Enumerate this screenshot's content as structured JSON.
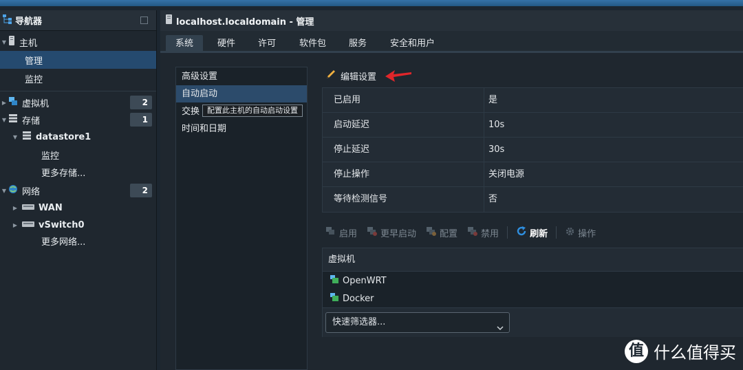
{
  "navigator": {
    "title": "导航器",
    "host": "主机",
    "host_manage": "管理",
    "host_monitor": "监控",
    "vms": "虚拟机",
    "vms_count": "2",
    "storage": "存储",
    "storage_count": "1",
    "datastore": "datastore1",
    "datastore_monitor": "监控",
    "more_storage": "更多存储...",
    "network": "网络",
    "network_count": "2",
    "wan": "WAN",
    "vswitch": "vSwitch0",
    "more_network": "更多网络..."
  },
  "window": {
    "title": "localhost.localdomain - 管理"
  },
  "tabs": [
    "系统",
    "硬件",
    "许可",
    "软件包",
    "服务",
    "安全和用户"
  ],
  "sublist": {
    "items": [
      "高级设置",
      "自动启动",
      "交换",
      "时间和日期"
    ],
    "tooltip": "配置此主机的自动启动设置"
  },
  "edit_label": "编辑设置",
  "properties": [
    {
      "key": "已启用",
      "value": "是"
    },
    {
      "key": "启动延迟",
      "value": "10s"
    },
    {
      "key": "停止延迟",
      "value": "30s"
    },
    {
      "key": "停止操作",
      "value": "关闭电源"
    },
    {
      "key": "等待检测信号",
      "value": "否"
    }
  ],
  "toolbar": {
    "enable": "启用",
    "start_earlier": "更早启动",
    "configure": "配置",
    "disable": "禁用",
    "refresh": "刷新",
    "actions": "操作"
  },
  "vm_list": {
    "header": "虚拟机",
    "rows": [
      "OpenWRT",
      "Docker"
    ],
    "filter_placeholder": "快速筛选器..."
  },
  "watermark": {
    "badge": "值",
    "text": "什么值得买"
  },
  "colors": {
    "selection": "#254a6f",
    "accent_arrow": "#e0262a",
    "refresh_blue": "#2f8fe0"
  }
}
